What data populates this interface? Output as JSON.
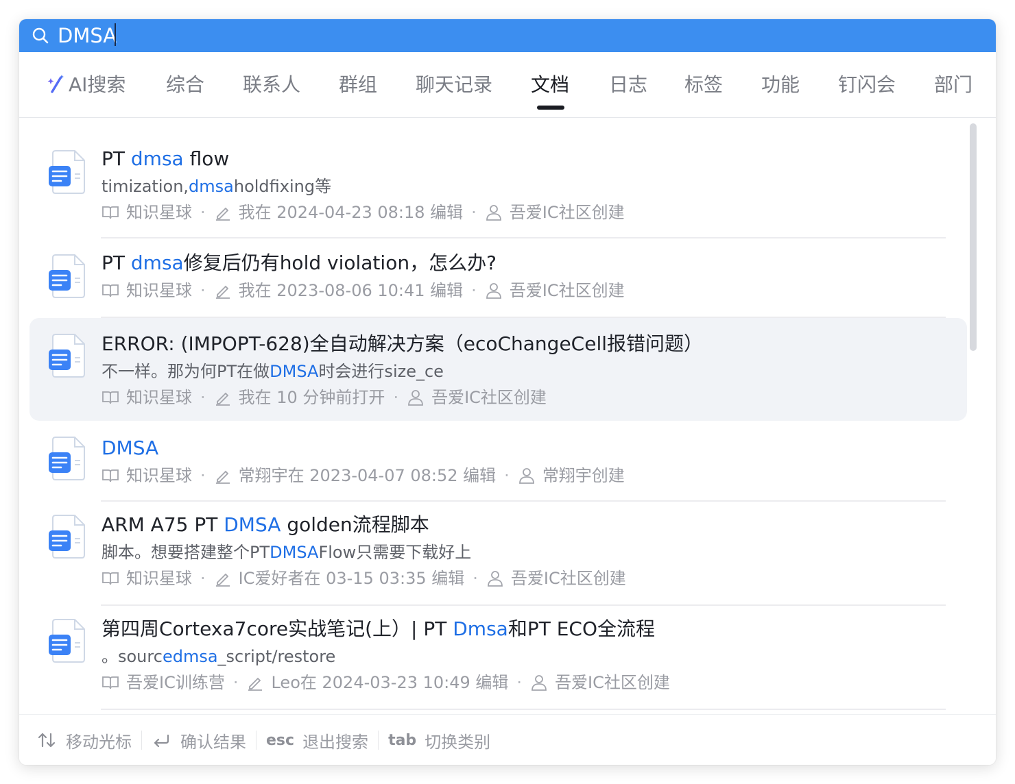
{
  "search": {
    "value": "DMSA"
  },
  "tabs": [
    {
      "label": "AI搜索"
    },
    {
      "label": "综合"
    },
    {
      "label": "联系人"
    },
    {
      "label": "群组"
    },
    {
      "label": "聊天记录"
    },
    {
      "label": "文档"
    },
    {
      "label": "日志"
    },
    {
      "label": "标签"
    },
    {
      "label": "功能"
    },
    {
      "label": "钉闪会"
    },
    {
      "label": "部门"
    }
  ],
  "active_tab": "文档",
  "results": [
    {
      "title_pre": "PT ",
      "title_hl": "dmsa",
      "title_post": " flow",
      "snippet_pre": "timization,",
      "snippet_hl": "dmsa",
      "snippet_post": "holdfixing等",
      "source": "知识星球",
      "edit": "我在 2024-04-23 08:18 编辑",
      "creator": "吾爱IC社区创建"
    },
    {
      "title_pre": "PT ",
      "title_hl": "dmsa",
      "title_post": "修复后仍有hold violation，怎么办?",
      "source": "知识星球",
      "edit": "我在 2023-08-06 10:41 编辑",
      "creator": "吾爱IC社区创建"
    },
    {
      "title_pre": "ERROR: (IMPOPT-628)全自动解决方案（ecoChangeCell报错问题）",
      "title_hl": "",
      "title_post": "",
      "snippet_pre": "不一样。那为何PT在做",
      "snippet_hl": "DMSA",
      "snippet_post": "时会进行size_ce",
      "source": "知识星球",
      "edit": "我在 10 分钟前打开",
      "creator": "吾爱IC社区创建"
    },
    {
      "title_pre": "",
      "title_hl": "DMSA",
      "title_post": "",
      "source": "知识星球",
      "edit": "常翔宇在 2023-04-07 08:52 编辑",
      "creator": "常翔宇创建"
    },
    {
      "title_pre": "ARM A75 PT ",
      "title_hl": "DMSA",
      "title_post": " golden流程脚本",
      "snippet_pre": "脚本。想要搭建整个PT",
      "snippet_hl": "DMSA",
      "snippet_post": "Flow只需要下载好上",
      "source": "知识星球",
      "edit": "IC爱好者在 03-15 03:35 编辑",
      "creator": "吾爱IC社区创建"
    },
    {
      "title_pre": "第四周Cortexa7core实战笔记(上）| PT ",
      "title_hl": "Dmsa",
      "title_post": "和PT ECO全流程",
      "snippet_pre": "。sourc",
      "snippet_hl": "edmsa",
      "snippet_post": "_script/restore",
      "source": "吾爱IC训练营",
      "edit": "Leo在 2024-03-23 10:49 编辑",
      "creator": "吾爱IC社区创建"
    }
  ],
  "footer": {
    "move": "移动光标",
    "confirm": "确认结果",
    "esc_key": "esc",
    "esc": "退出搜索",
    "tab_key": "tab",
    "tab": "切换类别"
  },
  "colors": {
    "search_bar": "#3c8ef0",
    "highlight": "#1f6fe5",
    "doc_icon": "#3b82f6",
    "selected_row": "#f1f3f7"
  }
}
